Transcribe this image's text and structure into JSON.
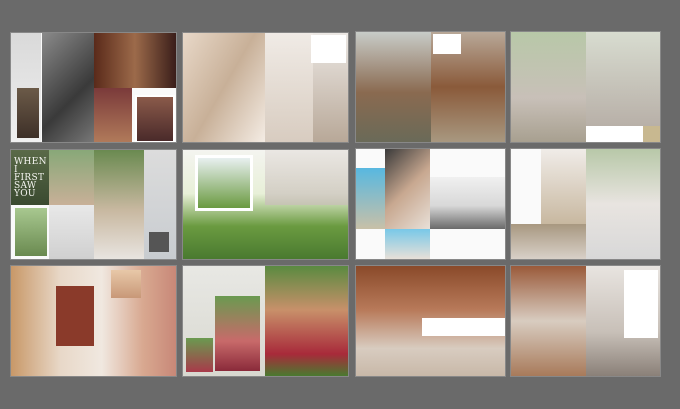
{
  "gallery": {
    "spreads": [
      {
        "title": "album-spread-1"
      },
      {
        "title": "album-spread-2"
      },
      {
        "title": "album-spread-3"
      },
      {
        "title": "album-spread-4"
      },
      {
        "title": "album-spread-5",
        "heading": "WHEN I FIRST SAW YOU"
      },
      {
        "title": "album-spread-6"
      },
      {
        "title": "album-spread-7"
      },
      {
        "title": "album-spread-8"
      },
      {
        "title": "album-spread-9"
      },
      {
        "title": "album-spread-10"
      },
      {
        "title": "album-spread-11"
      },
      {
        "title": "album-spread-12"
      }
    ]
  },
  "colors": {
    "background": "#6a6a6a",
    "page": "#fafafa"
  }
}
